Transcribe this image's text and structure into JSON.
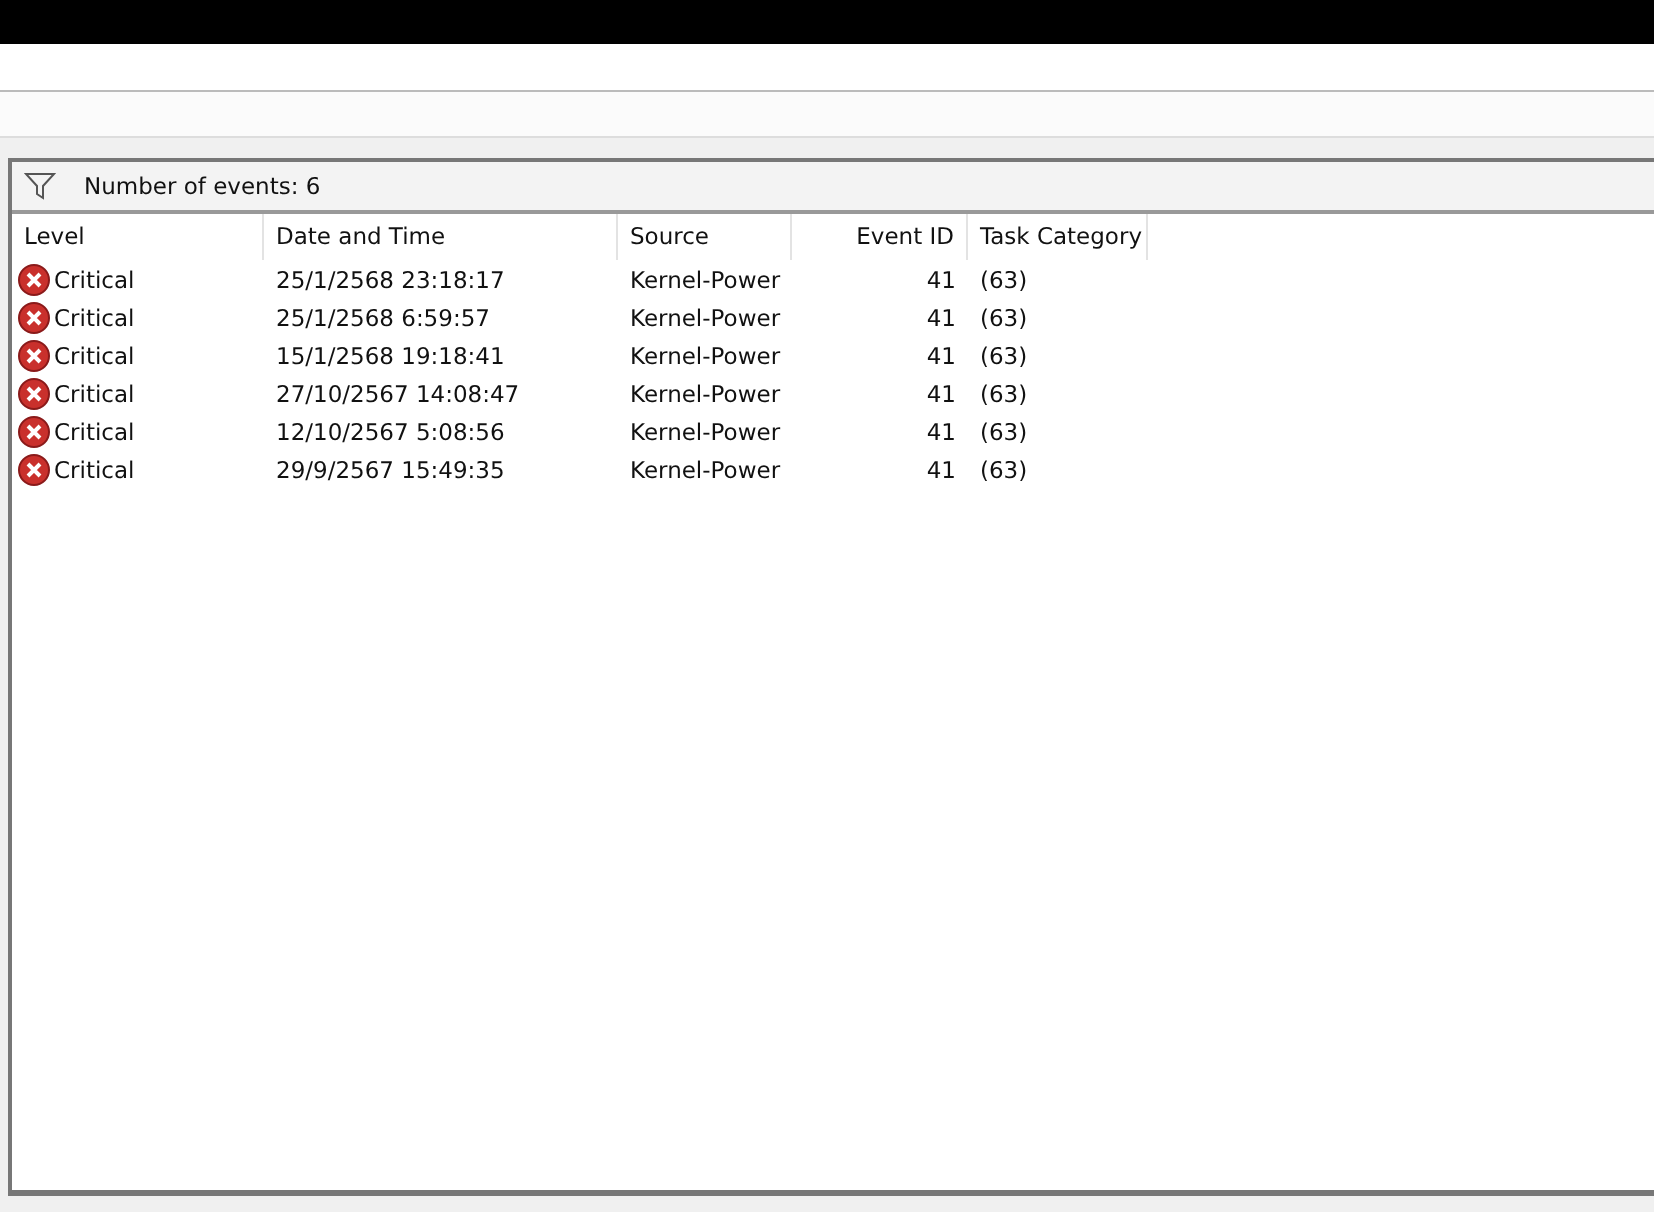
{
  "summary": {
    "label": "Number of events: 6"
  },
  "table": {
    "columns": [
      "Level",
      "Date and Time",
      "Source",
      "Event ID",
      "Task Category"
    ],
    "rows": [
      {
        "level": "Critical",
        "kind": "critical",
        "date": "25/1/2568 23:18:17",
        "source": "Kernel-Power",
        "event_id": "41",
        "task_category": "(63)"
      },
      {
        "level": "Critical",
        "kind": "critical",
        "date": "25/1/2568 6:59:57",
        "source": "Kernel-Power",
        "event_id": "41",
        "task_category": "(63)"
      },
      {
        "level": "Critical",
        "kind": "critical",
        "date": "15/1/2568 19:18:41",
        "source": "Kernel-Power",
        "event_id": "41",
        "task_category": "(63)"
      },
      {
        "level": "Critical",
        "kind": "critical",
        "date": "27/10/2567 14:08:47",
        "source": "Kernel-Power",
        "event_id": "41",
        "task_category": "(63)"
      },
      {
        "level": "Critical",
        "kind": "critical",
        "date": "12/10/2567 5:08:56",
        "source": "Kernel-Power",
        "event_id": "41",
        "task_category": "(63)"
      },
      {
        "level": "Critical",
        "kind": "critical",
        "date": "29/9/2567 15:49:35",
        "source": "Kernel-Power",
        "event_id": "41",
        "task_category": "(63)"
      }
    ]
  }
}
